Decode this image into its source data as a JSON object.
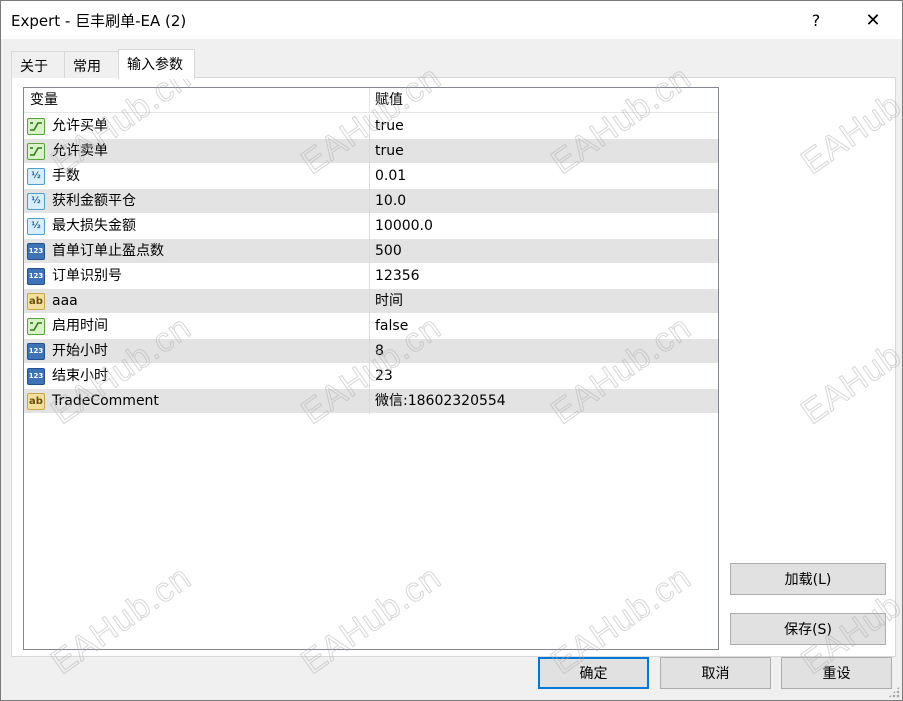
{
  "window": {
    "title": "Expert - 巨丰刷单-EA (2)",
    "help_label": "?",
    "close_label": "✕"
  },
  "tabs": [
    {
      "label": "关于",
      "active": false
    },
    {
      "label": "常用",
      "active": false
    },
    {
      "label": "输入参数",
      "active": true
    }
  ],
  "grid": {
    "headers": {
      "variable": "变量",
      "value": "赋值"
    },
    "rows": [
      {
        "type": "bool",
        "name": "允许买单",
        "value": "true"
      },
      {
        "type": "bool",
        "name": "允许卖单",
        "value": "true"
      },
      {
        "type": "double",
        "name": "手数",
        "value": "0.01"
      },
      {
        "type": "double",
        "name": "获利金额平仓",
        "value": "10.0"
      },
      {
        "type": "double",
        "name": "最大损失金额",
        "value": "10000.0"
      },
      {
        "type": "int",
        "name": "首单订单止盈点数",
        "value": "500"
      },
      {
        "type": "int",
        "name": "订单识别号",
        "value": "12356"
      },
      {
        "type": "string",
        "name": "aaa",
        "value": "时间"
      },
      {
        "type": "bool",
        "name": "启用时间",
        "value": "false"
      },
      {
        "type": "int",
        "name": "开始小时",
        "value": "8"
      },
      {
        "type": "int",
        "name": "结束小时",
        "value": "23"
      },
      {
        "type": "string",
        "name": "TradeComment",
        "value": "微信:18602320554"
      }
    ]
  },
  "icons": {
    "bool": "bool-icon",
    "double": "double-icon",
    "int": "int-icon",
    "string": "string-icon",
    "int_glyph": "123",
    "double_glyph": "½",
    "string_glyph": "ab"
  },
  "buttons": {
    "load": "加载(L)",
    "save": "保存(S)",
    "ok": "确定",
    "cancel": "取消",
    "reset": "重设"
  },
  "watermark": "EAHub.cn",
  "colors": {
    "row_alt": "#e3e3e3",
    "default_button_border": "#0078d7",
    "grid_border": "#828790"
  }
}
